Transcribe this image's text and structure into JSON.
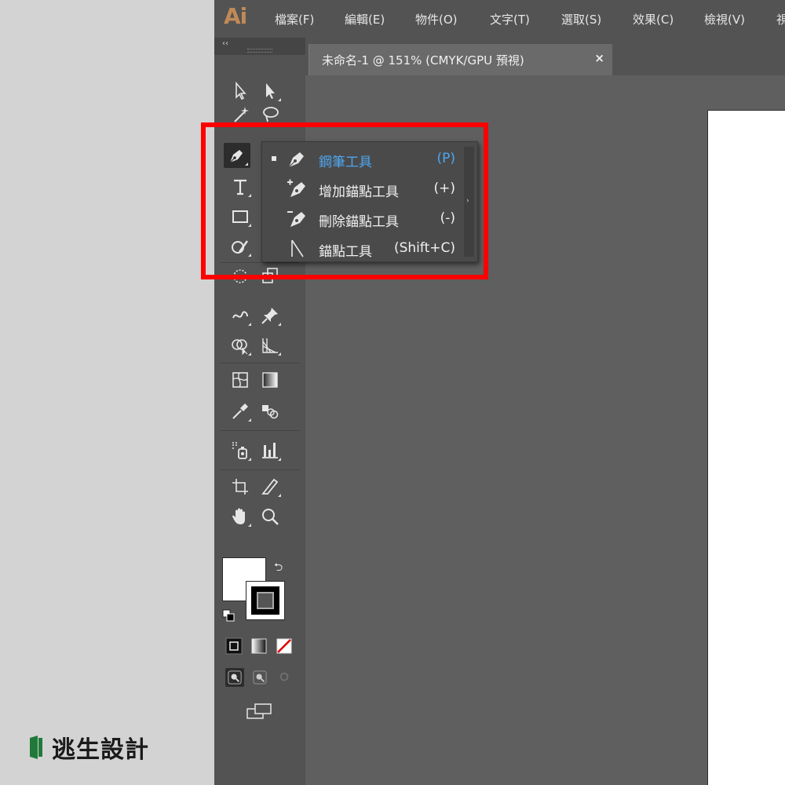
{
  "app": {
    "logo": "Ai"
  },
  "menu": {
    "items": [
      {
        "label": "檔案(F)"
      },
      {
        "label": "編輯(E)"
      },
      {
        "label": "物件(O)"
      },
      {
        "label": "文字(T)"
      },
      {
        "label": "選取(S)"
      },
      {
        "label": "效果(C)"
      },
      {
        "label": "檢視(V)"
      },
      {
        "label": "視"
      }
    ]
  },
  "document": {
    "tab_title": "未命名-1 @ 151% (CMYK/GPU 預視)",
    "close_label": "×"
  },
  "toolbar": {
    "collapse_label": "‹‹"
  },
  "flyout": {
    "items": [
      {
        "label": "鋼筆工具",
        "shortcut": "(P)",
        "icon": "pen-icon",
        "selected": true
      },
      {
        "label": "增加錨點工具",
        "shortcut": "(+)",
        "icon": "add-anchor-point-icon",
        "selected": false
      },
      {
        "label": "刪除錨點工具",
        "shortcut": "(-)",
        "icon": "delete-anchor-point-icon",
        "selected": false
      },
      {
        "label": "錨點工具",
        "shortcut": "(Shift+C)",
        "icon": "anchor-point-icon",
        "selected": false
      }
    ],
    "tearoff_label": "›"
  },
  "colors": {
    "highlight": "#ff0000",
    "selected_text": "#4ea6f0",
    "logo": "#c08a57",
    "brand": "#1f7a3a"
  },
  "brand": {
    "name": "逃生設計"
  }
}
